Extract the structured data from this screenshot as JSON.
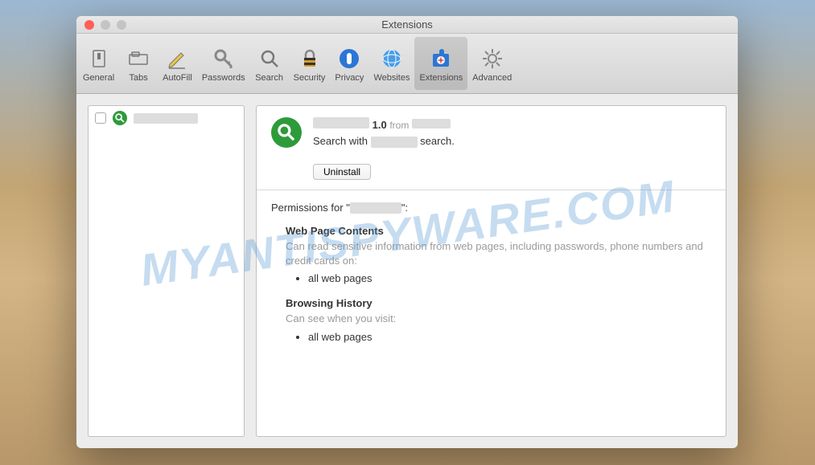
{
  "window": {
    "title": "Extensions"
  },
  "toolbar": {
    "items": [
      {
        "label": "General"
      },
      {
        "label": "Tabs"
      },
      {
        "label": "AutoFill"
      },
      {
        "label": "Passwords"
      },
      {
        "label": "Search"
      },
      {
        "label": "Security"
      },
      {
        "label": "Privacy"
      },
      {
        "label": "Websites"
      },
      {
        "label": "Extensions"
      },
      {
        "label": "Advanced"
      }
    ]
  },
  "sidebar": {
    "items": [
      {
        "name_redacted": true
      }
    ]
  },
  "detail": {
    "version": "1.0",
    "from_label": "from",
    "desc_prefix": "Search with",
    "desc_suffix": "search.",
    "uninstall_label": "Uninstall",
    "permissions_prefix": "Permissions for \"",
    "permissions_suffix": "\":",
    "groups": [
      {
        "heading": "Web Page Contents",
        "desc": "Can read sensitive information from web pages, including passwords, phone numbers and credit cards on:",
        "items": [
          "all web pages"
        ]
      },
      {
        "heading": "Browsing History",
        "desc": "Can see when you visit:",
        "items": [
          "all web pages"
        ]
      }
    ]
  },
  "watermark": "MYANTISPYWARE.COM"
}
